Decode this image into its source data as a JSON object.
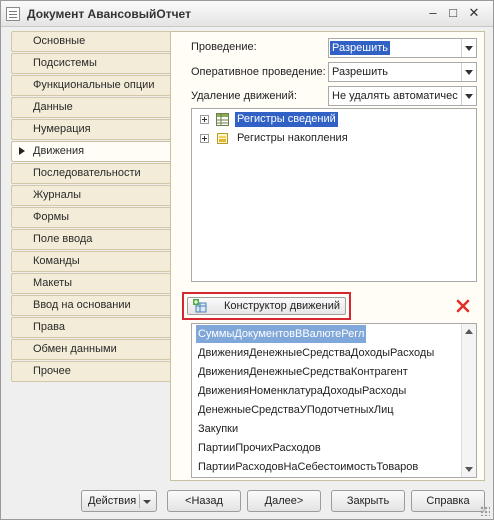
{
  "window": {
    "title": "Документ АвансовыйОтчет"
  },
  "nav": {
    "items": [
      {
        "label": "Основные"
      },
      {
        "label": "Подсистемы"
      },
      {
        "label": "Функциональные опции"
      },
      {
        "label": "Данные"
      },
      {
        "label": "Нумерация"
      },
      {
        "label": "Движения",
        "active": true
      },
      {
        "label": "Последовательности"
      },
      {
        "label": "Журналы"
      },
      {
        "label": "Формы"
      },
      {
        "label": "Поле ввода"
      },
      {
        "label": "Команды"
      },
      {
        "label": "Макеты"
      },
      {
        "label": "Ввод на основании"
      },
      {
        "label": "Права"
      },
      {
        "label": "Обмен данными"
      },
      {
        "label": "Прочее"
      }
    ]
  },
  "fields": {
    "posting_label": "Проведение:",
    "posting_value": "Разрешить",
    "realtime_label": "Оперативное проведение:",
    "realtime_value": "Разрешить",
    "delete_label": "Удаление движений:",
    "delete_value": "Не удалять автоматически"
  },
  "tree": {
    "items": [
      {
        "label": "Регистры сведений",
        "icon": "table-register-icon",
        "selected": true
      },
      {
        "label": "Регистры накопления",
        "icon": "accumulation-register-icon",
        "selected": false
      }
    ]
  },
  "constructor_button": {
    "label": "Конструктор движений"
  },
  "registers": {
    "items": [
      {
        "label": "СуммыДокументовВВалютеРегл",
        "selected": true
      },
      {
        "label": "ДвиженияДенежныеСредстваДоходыРасходы"
      },
      {
        "label": "ДвиженияДенежныеСредстваКонтрагент"
      },
      {
        "label": "ДвиженияНоменклатураДоходыРасходы"
      },
      {
        "label": "ДенежныеСредстваУПодотчетныхЛиц"
      },
      {
        "label": "Закупки"
      },
      {
        "label": "ПартииПрочихРасходов"
      },
      {
        "label": "ПартииРасходовНаСебестоимостьТоваров"
      }
    ]
  },
  "footer": {
    "actions_label": "Действия",
    "back_label": "<Назад",
    "next_label": "Далее>",
    "close_label": "Закрыть",
    "help_label": "Справка"
  },
  "colors": {
    "selection": "#3161c5",
    "list_selection": "#7fa7d9",
    "highlight_border": "#d4272f",
    "delete_icon": "#e0302a",
    "nav_tab": "#f3ecd8"
  }
}
